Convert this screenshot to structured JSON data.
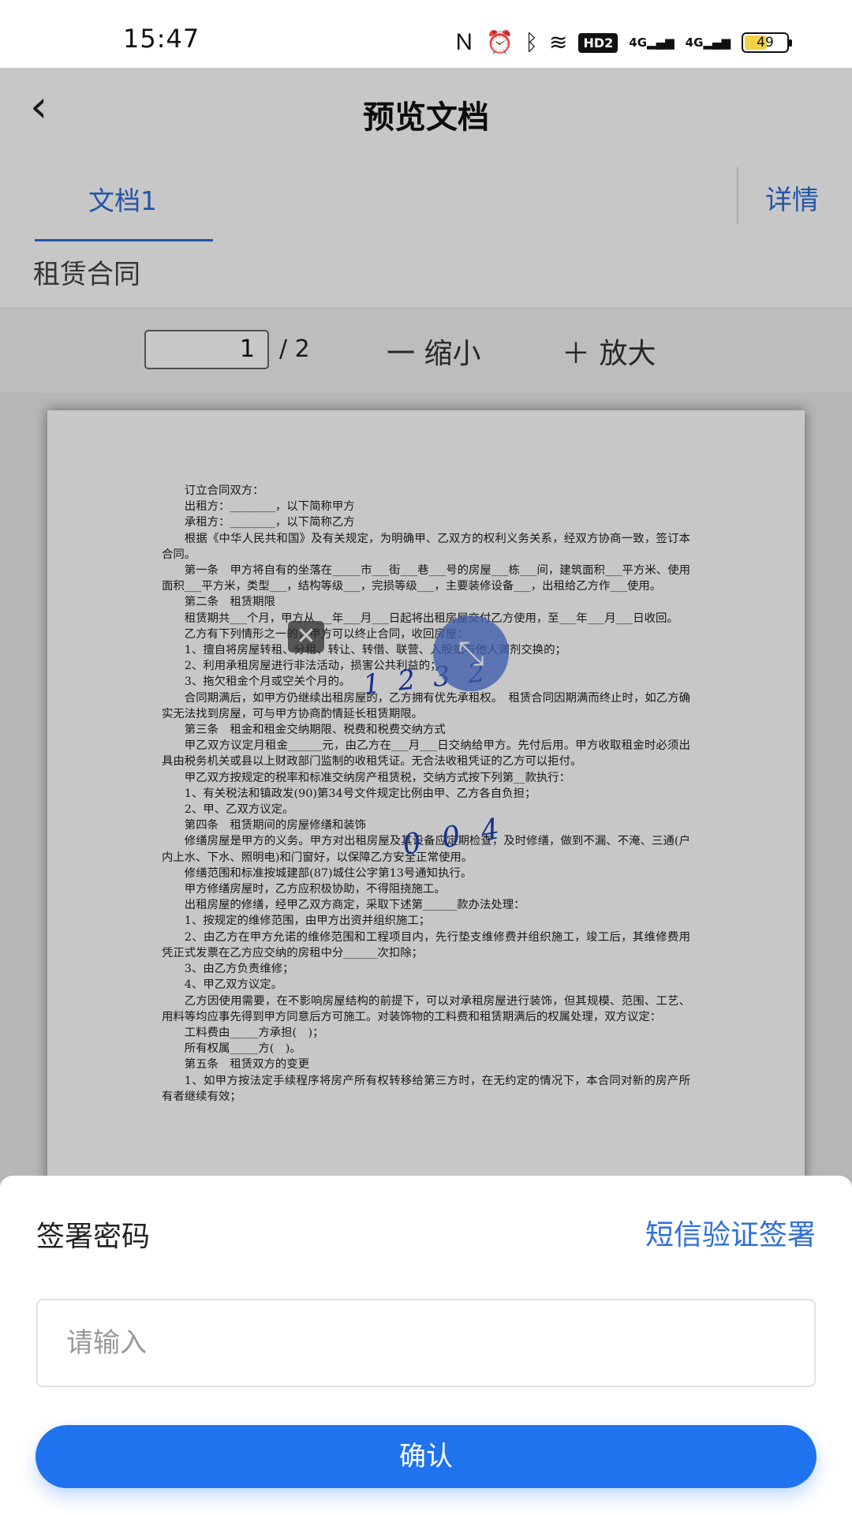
{
  "status_bar": {
    "time": "15:47",
    "icons": [
      "nfc-icon",
      "alarm-icon",
      "bluetooth-icon",
      "wifi-icon"
    ],
    "hd_label": "HD2",
    "signal1": "4G",
    "signal2": "4G",
    "battery": "49"
  },
  "header": {
    "back_icon": "‹",
    "title": "预览文档"
  },
  "tabs": {
    "tab1": "文档1",
    "detail": "详情"
  },
  "doc_name": "租赁合同",
  "toolbar": {
    "page_value": "1",
    "page_total": "/ 2",
    "zoom_out": "一  缩小",
    "zoom_in": "＋  放大"
  },
  "document": {
    "paragraphs": [
      "订立合同双方：",
      "出租方：________，以下简称甲方",
      "承租方：________，以下简称乙方",
      "根据《中华人民共和国》及有关规定，为明确甲、乙双方的权利义务关系，经双方协商一致，签订本合同。",
      "第一条　甲方将自有的坐落在_____市___街___巷___号的房屋___栋___间，建筑面积___平方米、使用面积___平方米，类型___，结构等级___，完损等级___，主要装修设备___，出租给乙方作___使用。",
      "第二条　租赁期限",
      "租赁期共___个月，甲方从___年___月___日起将出租房屋交付乙方使用，至___年___月___日收回。",
      "乙方有下列情形之一的，甲方可以终止合同，收回房屋：",
      "1、擅自将房屋转租、分租、转让、转借、联营、入股或与他人调剂交换的；",
      "2、利用承租房屋进行非法活动，损害公共利益的；",
      "3、拖欠租金个月或空关个月的。",
      "合同期满后，如甲方仍继续出租房屋的，乙方拥有优先承租权。　租赁合同因期满而终止时，如乙方确实无法找到房屋，可与甲方协商酌情延长租赁期限。",
      "第三条　租金和租金交纳期限、税费和税费交纳方式",
      "甲乙双方议定月租金______元，由乙方在___月___日交纳给甲方。先付后用。甲方收取租金时必须出具由税务机关或县以上财政部门监制的收租凭证。无合法收租凭证的乙方可以拒付。",
      "甲乙双方按规定的税率和标准交纳房产租赁税，交纳方式按下列第__款执行：",
      "1、有关税法和镇政发(90)第34号文件规定比例由甲、乙方各自负担；",
      "2、甲、乙双方议定。",
      "第四条　租赁期间的房屋修缮和装饰",
      "修缮房屋是甲方的义务。甲方对出租房屋及其设备应定期检查，及时修缮，做到不漏、不淹、三通(户内上水、下水、照明电)和门窗好，以保障乙方安全正常使用。",
      "修缮范围和标准按城建部(87)城住公字第13号通知执行。",
      "甲方修缮房屋时，乙方应积极协助，不得阻挠施工。",
      "出租房屋的修缮，经甲乙双方商定，采取下述第______款办法处理：",
      "1、按规定的维修范围，由甲方出资并组织施工；",
      "2、由乙方在甲方允诺的维修范围和工程项目内，先行垫支维修费并组织施工，竣工后，其维修费用凭正式发票在乙方应交纳的房租中分______次扣除；",
      "3、由乙方负责维修；",
      "4、甲乙双方议定。",
      "乙方因使用需要，在不影响房屋结构的前提下，可以对承租房屋进行装饰，但其规模、范围、工艺、用料等均应事先得到甲方同意后方可施工。对装饰物的工料费和租赁期满后的权属处理，双方议定：",
      "工料费由_____方承担(　)；",
      "所有权属_____方(　)。",
      "第五条　租赁双方的变更",
      "1、如甲方按法定手续程序将房产所有权转移给第三方时，在无约定的情况下，本合同对新的房产所有者继续有效；"
    ],
    "handwriting_1": "1 2 3 2",
    "handwriting_2": "0 0 4",
    "float_close": "✕",
    "float_bubble": "⤡"
  },
  "sheet": {
    "title": "签署密码",
    "sms_link": "短信验证签署",
    "input_placeholder": "请输入",
    "confirm": "确认"
  }
}
